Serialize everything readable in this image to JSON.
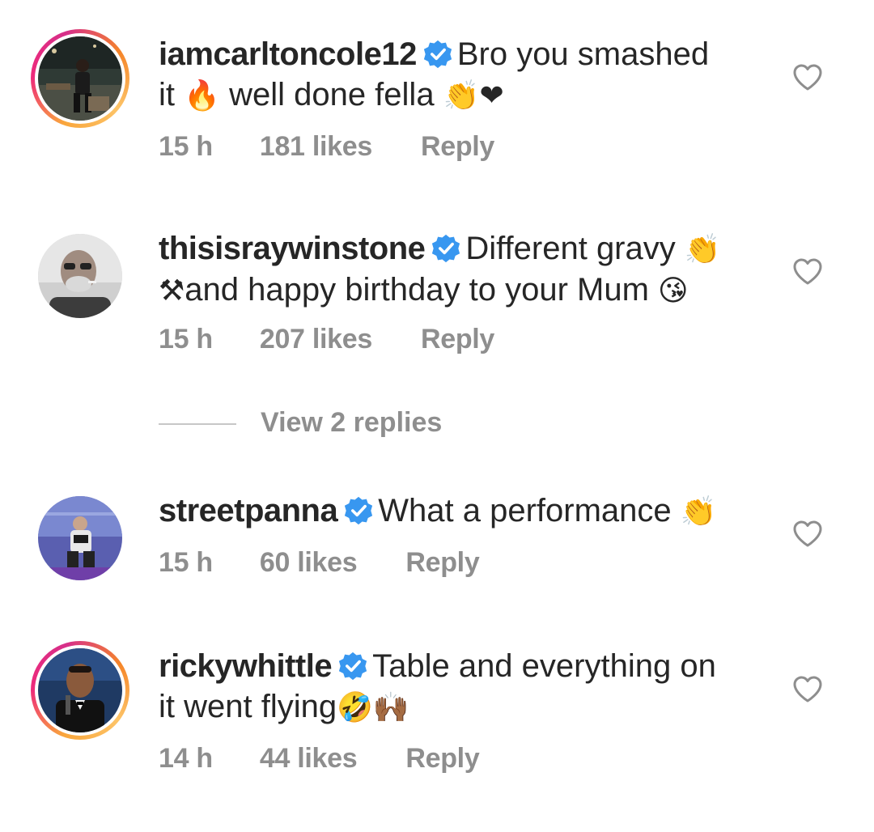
{
  "comments": [
    {
      "username": "iamcarltoncole12",
      "verified": true,
      "has_story": true,
      "text_1": "Bro you smashed",
      "text_2": "it ",
      "emoji_fire": "🔥",
      "text_3": " well done fella ",
      "emoji_end": "👏❤",
      "time": "15 h",
      "likes": "181 likes",
      "reply_label": "Reply"
    },
    {
      "username": "thisisraywinstone",
      "verified": true,
      "has_story": false,
      "text_1": "Different gravy ",
      "emoji_a": "👏",
      "emoji_b": "⚒",
      "text_2": "and happy birthday to your Mum ",
      "emoji_c": "😘",
      "time": "15 h",
      "likes": "207 likes",
      "reply_label": "Reply"
    },
    {
      "username": "streetpanna",
      "verified": true,
      "has_story": false,
      "text_1": "What a performance ",
      "emoji_a": "👏",
      "time": "15 h",
      "likes": "60 likes",
      "reply_label": "Reply"
    },
    {
      "username": "rickywhittle",
      "verified": true,
      "has_story": true,
      "text_1": "Table and everything on",
      "text_2": "it went flying",
      "emoji_a": "🤣🙌🏾",
      "time": "14 h",
      "likes": "44 likes",
      "reply_label": "Reply"
    }
  ],
  "view_replies_label": "View 2 replies",
  "colors": {
    "verified_blue": "#3897f0",
    "meta_gray": "#8e8e8e",
    "text": "#262626"
  },
  "icons": {
    "like": "heart-outline-icon",
    "verified": "verified-badge-icon"
  }
}
